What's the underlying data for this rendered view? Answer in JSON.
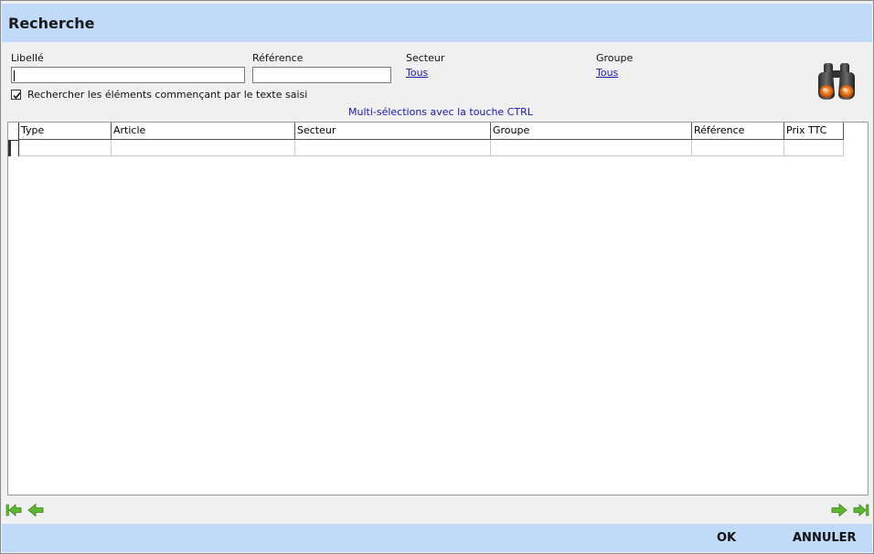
{
  "window": {
    "title": "Recherche"
  },
  "filters": {
    "libelle_label": "Libellé",
    "libelle_value": "",
    "reference_label": "Référence",
    "reference_value": "",
    "secteur_label": "Secteur",
    "secteur_value": "Tous",
    "groupe_label": "Groupe",
    "groupe_value": "Tous",
    "starts_with_label": "Rechercher les éléments commençant par le texte saisi",
    "starts_with_checked": true,
    "multi_select_hint": "Multi-sélections avec la touche CTRL"
  },
  "search_button": {
    "icon": "binoculars-icon"
  },
  "grid": {
    "columns": [
      "Type",
      "Article",
      "Secteur",
      "Groupe",
      "Référence",
      "Prix TTC"
    ],
    "rows": []
  },
  "navigation": {
    "first_icon": "nav-first-icon",
    "prev_icon": "nav-prev-icon",
    "next_icon": "nav-next-icon",
    "last_icon": "nav-last-icon"
  },
  "colors": {
    "header_band": "#c1daf9",
    "link": "#1a1ab0",
    "nav_green": "#5cb82d"
  },
  "footer": {
    "ok_label": "OK",
    "cancel_label": "ANNULER"
  }
}
